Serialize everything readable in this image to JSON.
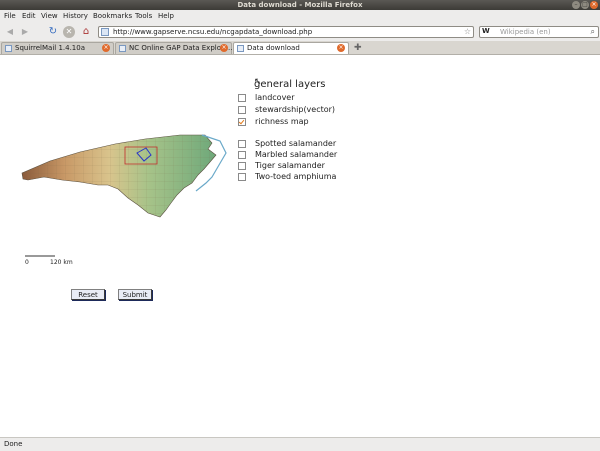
{
  "window": {
    "title": "Data download - Mozilla Firefox"
  },
  "menu": [
    "File",
    "Edit",
    "View",
    "History",
    "Bookmarks",
    "Tools",
    "Help"
  ],
  "nav": {
    "url": "http://www.gapserve.ncsu.edu/ncgapdata_download.php",
    "search_placeholder": "Wikipedia (en)",
    "search_engine_label": "W"
  },
  "tabs": [
    {
      "label": "SquirrelMail 1.4.10a",
      "active": false
    },
    {
      "label": "NC Online GAP Data Explore...",
      "active": false
    },
    {
      "label": "Data download",
      "active": true
    }
  ],
  "page": {
    "heading": "general layers",
    "general_layers": [
      {
        "label": "landcover",
        "checked": false
      },
      {
        "label": "stewardship(vector)",
        "checked": false
      },
      {
        "label": "richness map",
        "checked": true
      }
    ],
    "species": [
      {
        "label": "Spotted salamander",
        "checked": false
      },
      {
        "label": "Marbled salamander",
        "checked": false
      },
      {
        "label": "Tiger salamander",
        "checked": false
      },
      {
        "label": "Two-toed amphiuma",
        "checked": false
      }
    ],
    "scale": {
      "start": "0",
      "end": "120 km"
    },
    "reset_label": "Reset",
    "submit_label": "Submit"
  },
  "status": "Done",
  "colors": {
    "accent": "#e07a1a",
    "close_tab": "#e06a2c",
    "chrome": "#edeceb",
    "titlebar": "#3c3b37"
  }
}
